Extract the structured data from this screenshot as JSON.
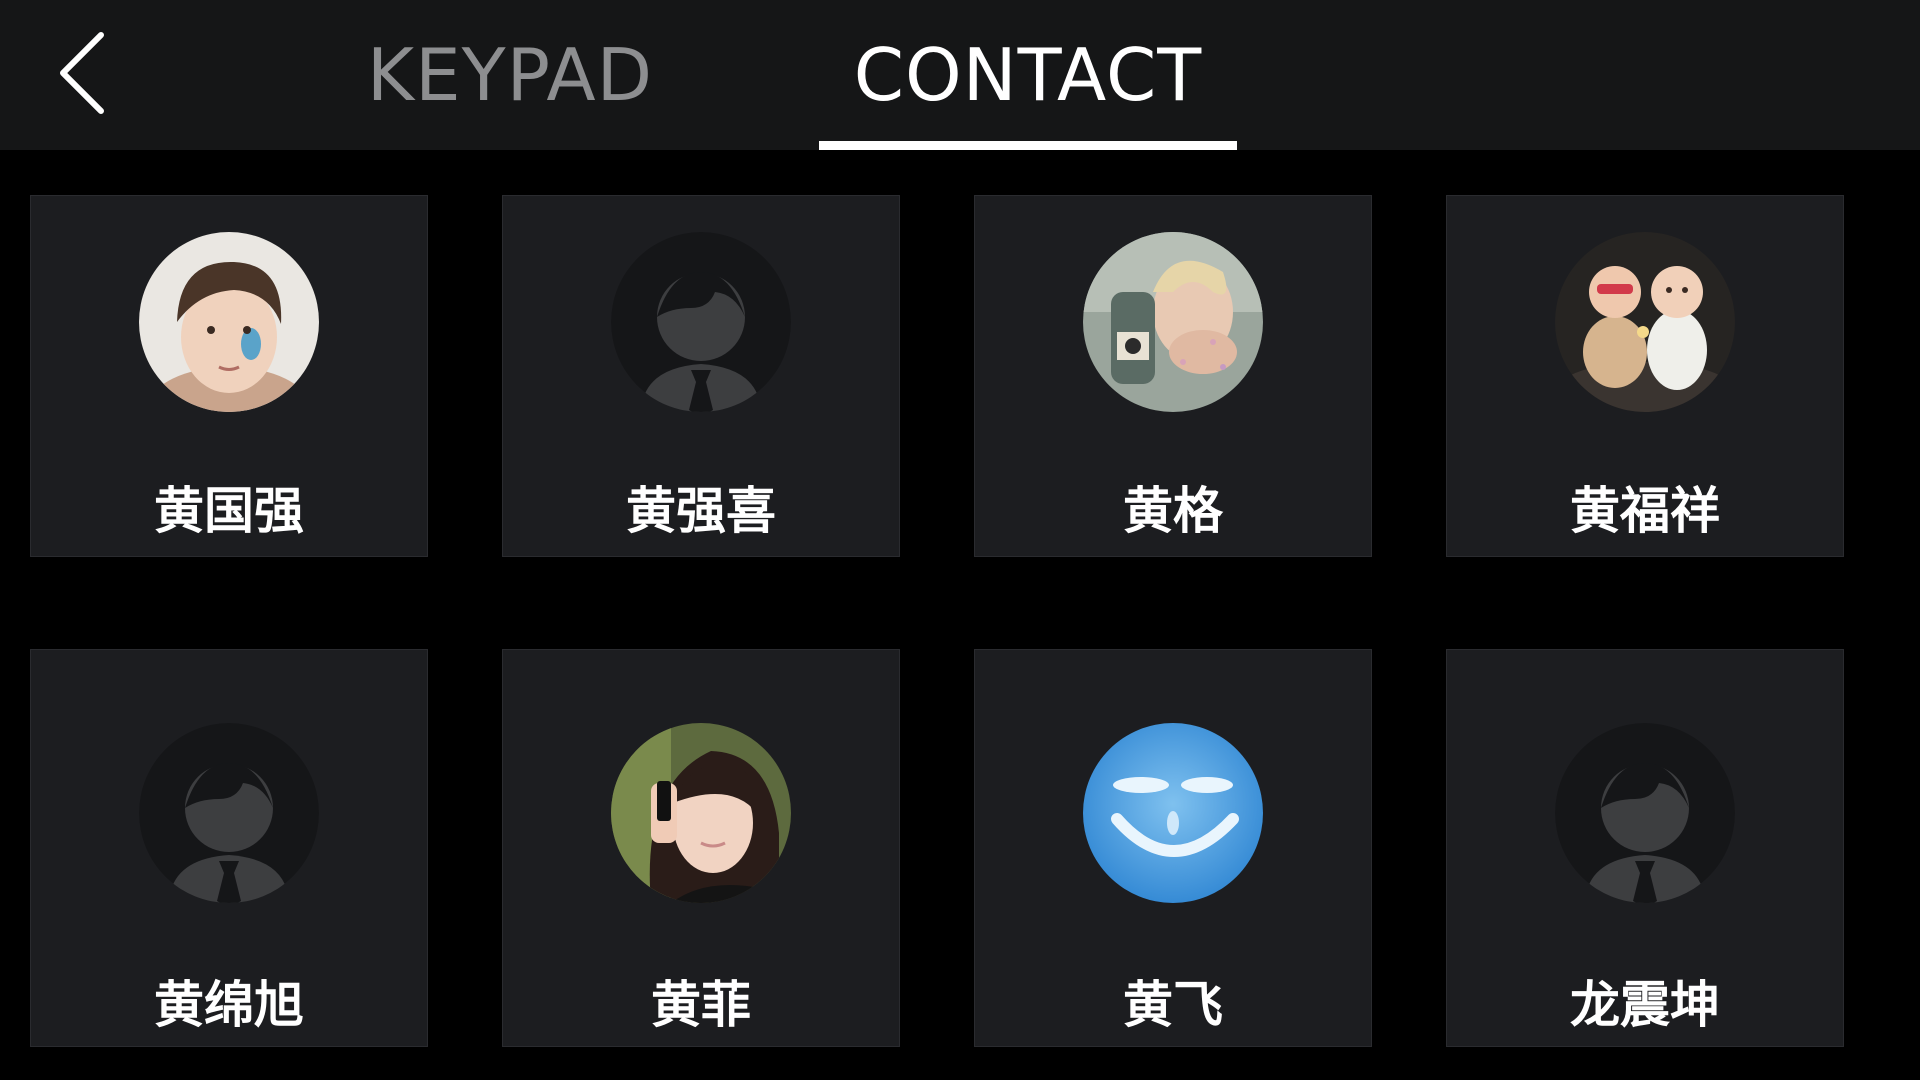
{
  "header": {
    "back_icon": "chevron-left-icon",
    "tabs": [
      {
        "label": "KEYPAD",
        "active": false
      },
      {
        "label": "CONTACT",
        "active": true
      }
    ]
  },
  "colors": {
    "header_bg": "#151617",
    "page_bg": "#000000",
    "card_bg": "#1c1d20",
    "active_tab": "#ffffff",
    "inactive_tab": "#8d8e90"
  },
  "contacts": [
    {
      "name": "黄国强",
      "avatar": "photo-boy-avatar"
    },
    {
      "name": "黄强喜",
      "avatar": "default-person-icon"
    },
    {
      "name": "黄格",
      "avatar": "photo-woman-avatar"
    },
    {
      "name": "黄福祥",
      "avatar": "photo-babies-avatar"
    },
    {
      "name": "黄绵旭",
      "avatar": "default-person-icon"
    },
    {
      "name": "黄菲",
      "avatar": "photo-girl-phone-avatar"
    },
    {
      "name": "黄飞",
      "avatar": "photo-sky-smile-avatar"
    },
    {
      "name": "龙震坤",
      "avatar": "default-person-icon"
    }
  ]
}
